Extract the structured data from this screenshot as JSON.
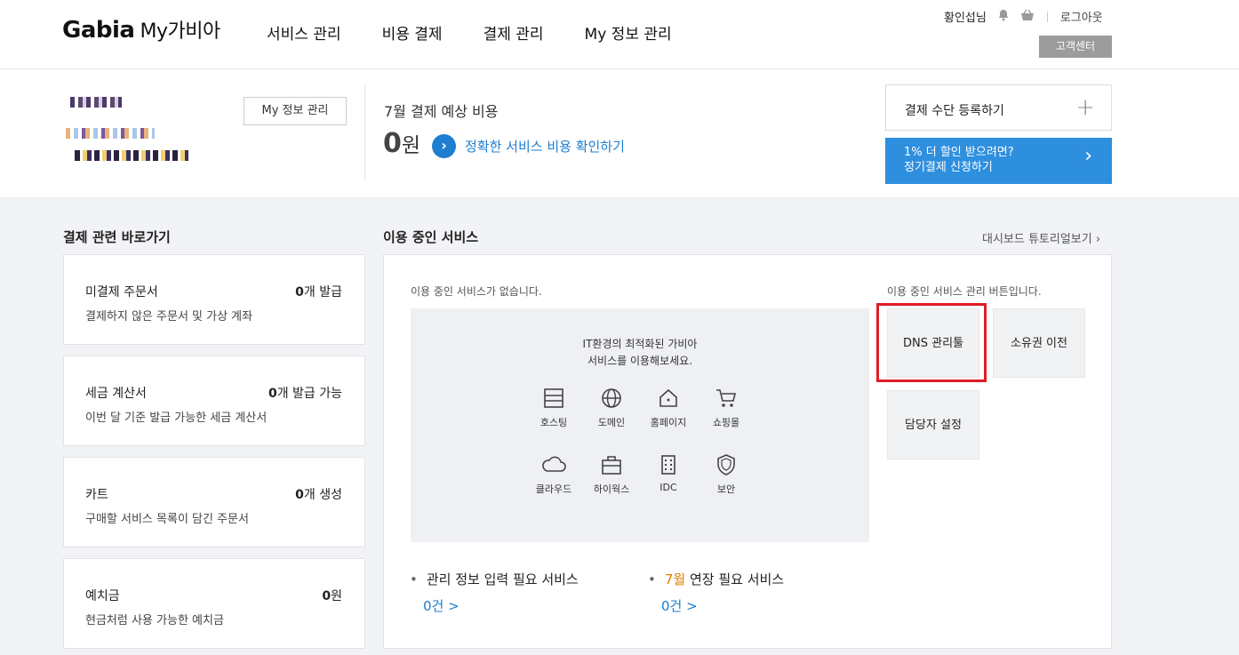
{
  "header": {
    "brand": "Gabia",
    "sub": "My가비아",
    "nav": [
      "서비스 관리",
      "비용 결제",
      "결제 관리",
      "My 정보 관리"
    ],
    "user_name": "황인섭님",
    "logout": "로그아웃",
    "customer_center": "고객센터"
  },
  "summary": {
    "my_info_button": "My 정보 관리",
    "cost_title": "7월 결제 예상 비용",
    "cost_amount": "0",
    "cost_unit": "원",
    "cost_link": "정확한 서비스 비용 확인하기",
    "payment_register": "결제 수단 등록하기",
    "promo_line1": "1% 더 할인 받으려면?",
    "promo_line2": "정기결제 신청하기"
  },
  "shortcuts": {
    "title": "결제 관련 바로가기",
    "cards": [
      {
        "title": "미결제 주문서",
        "count": "0",
        "suffix": "개 발급",
        "desc": "결제하지 않은 주문서 및 가상 계좌"
      },
      {
        "title": "세금 계산서",
        "count": "0",
        "suffix": "개 발급 가능",
        "desc": "이번 달 기준 발급 가능한 세금 계산서"
      },
      {
        "title": "카트",
        "count": "0",
        "suffix": "개 생성",
        "desc": "구매할 서비스 목록이 담긴 주문서"
      },
      {
        "title": "예치금",
        "count": "0",
        "suffix": "원",
        "desc": "현금처럼 사용 가능한 예치금"
      }
    ]
  },
  "services": {
    "title": "이용 중인 서비스",
    "tutorial_link": "대시보드 튜토리얼보기 ›",
    "empty_message": "이용 중인 서비스가 없습니다.",
    "intro_line1": "IT환경의 최적화된 가비아",
    "intro_line2": "서비스를 이용해보세요.",
    "items": [
      "호스팅",
      "도메인",
      "홈페이지",
      "쇼핑몰",
      "클라우드",
      "하이웍스",
      "IDC",
      "보안"
    ],
    "management_message": "이용 중인 서비스 관리 버튼입니다.",
    "management_buttons": [
      "DNS 관리툴",
      "소유권 이전",
      "담당자 설정"
    ],
    "status_left_label": "관리 정보 입력 필요 서비스",
    "status_left_count": "0건 >",
    "status_right_month": "7월",
    "status_right_label": " 연장 필요 서비스",
    "status_right_count": "0건 >"
  },
  "colors": {
    "accent_blue": "#1e7ed0",
    "promo_blue": "#2e8fde",
    "highlight_red": "#e01c25",
    "orange": "#e07b00"
  }
}
